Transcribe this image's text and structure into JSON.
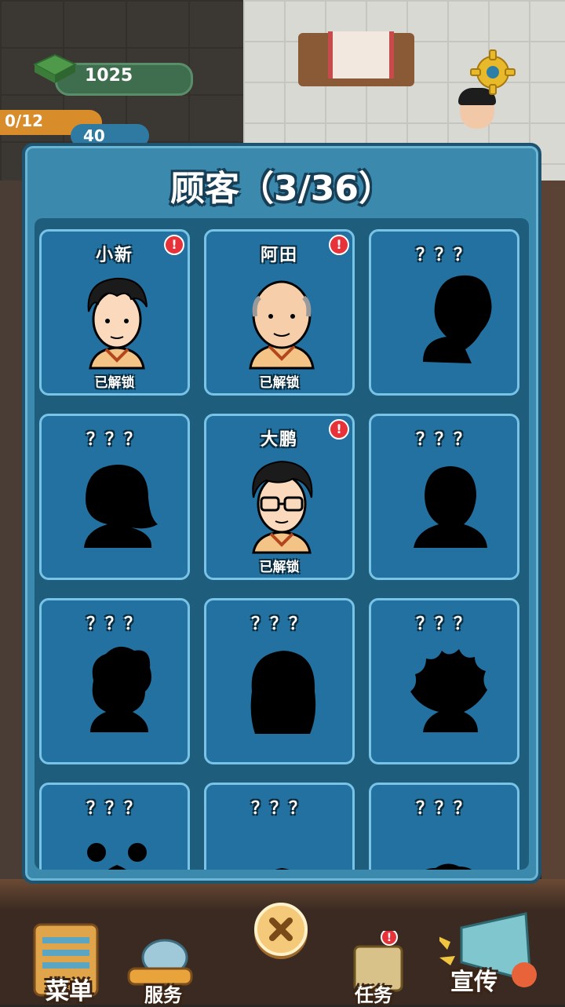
{
  "hud": {
    "money": "1025",
    "count": "0/12",
    "likes": "40"
  },
  "modal": {
    "title": "顾客（3/36）"
  },
  "customers": [
    {
      "name": "小新",
      "status": "已解锁",
      "unlocked": true,
      "alert": true,
      "portrait": "boy-portrait"
    },
    {
      "name": "阿田",
      "status": "已解锁",
      "unlocked": true,
      "alert": true,
      "portrait": "bald-man-portrait"
    },
    {
      "name": "？？？",
      "status": "",
      "unlocked": false,
      "alert": false,
      "portrait": "silhouette-curly"
    },
    {
      "name": "？？？",
      "status": "",
      "unlocked": false,
      "alert": false,
      "portrait": "silhouette-bob"
    },
    {
      "name": "大鹏",
      "status": "已解锁",
      "unlocked": true,
      "alert": true,
      "portrait": "glasses-man-portrait"
    },
    {
      "name": "？？？",
      "status": "",
      "unlocked": false,
      "alert": false,
      "portrait": "silhouette-short"
    },
    {
      "name": "？？？",
      "status": "",
      "unlocked": false,
      "alert": false,
      "portrait": "silhouette-wavy"
    },
    {
      "name": "？？？",
      "status": "",
      "unlocked": false,
      "alert": false,
      "portrait": "silhouette-long"
    },
    {
      "name": "？？？",
      "status": "",
      "unlocked": false,
      "alert": false,
      "portrait": "silhouette-spiky"
    },
    {
      "name": "？？？",
      "status": "",
      "unlocked": false,
      "alert": false,
      "portrait": "silhouette-buns"
    },
    {
      "name": "？？？",
      "status": "",
      "unlocked": false,
      "alert": false,
      "portrait": "silhouette-round"
    },
    {
      "name": "？？？",
      "status": "",
      "unlocked": false,
      "alert": false,
      "portrait": "silhouette-fluffy"
    }
  ],
  "nav": {
    "menu": "菜单",
    "service": "服务",
    "tasks": "任务",
    "promo": "宣传"
  },
  "colors": {
    "modal_bg": "#3b89ad",
    "card_bg": "#2271a0",
    "card_border": "#79c3e6",
    "alert": "#e8323a"
  }
}
